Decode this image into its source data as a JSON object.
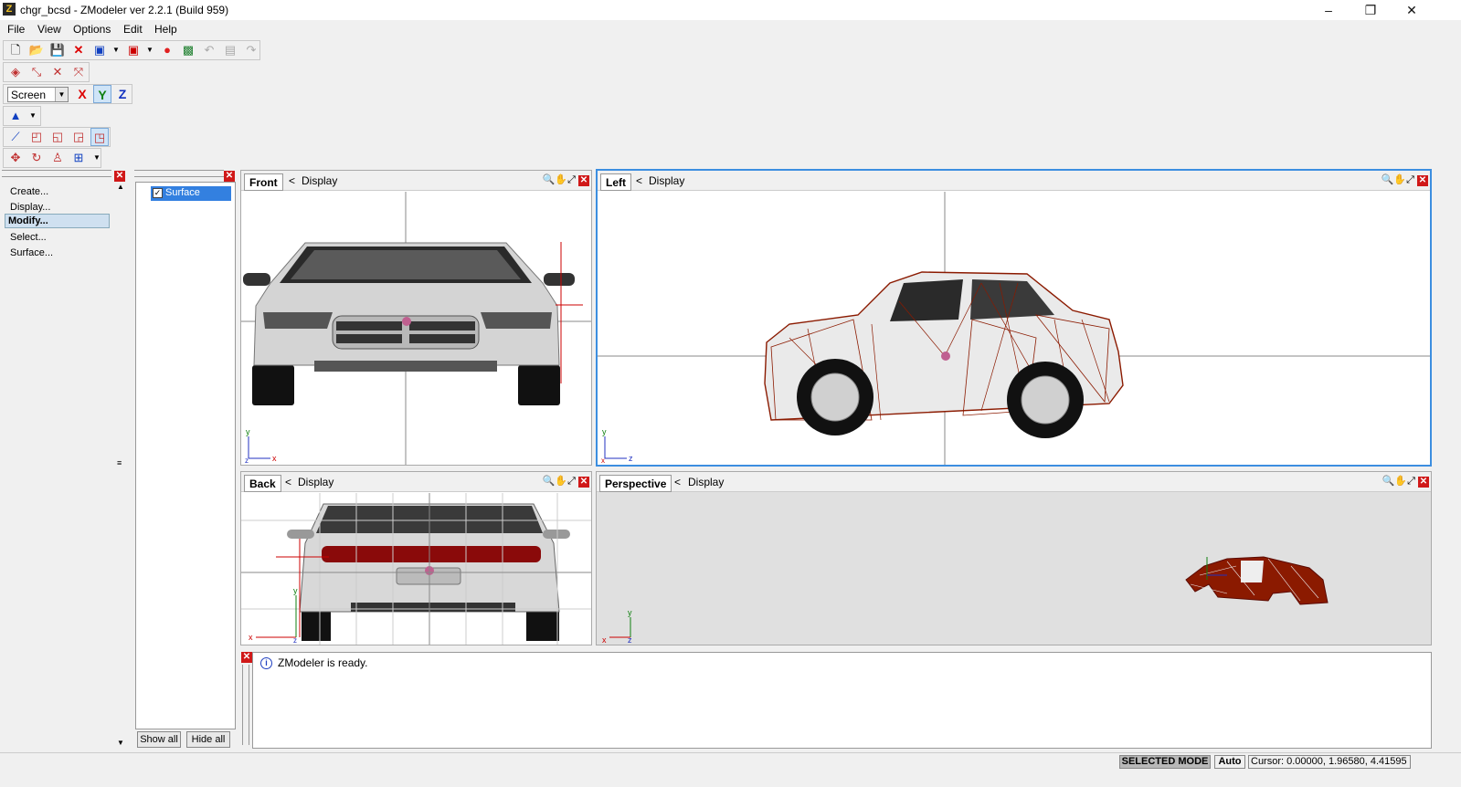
{
  "window": {
    "title": "chgr_bcsd - ZModeler ver 2.2.1 (Build 959)",
    "app_icon": "Z",
    "minimize": "–",
    "maximize": "❐",
    "close": "✕"
  },
  "menu": [
    "File",
    "View",
    "Options",
    "Edit",
    "Help"
  ],
  "toolbar": {
    "axis_mode": "Screen",
    "axis_x": "X",
    "axis_y": "Y",
    "axis_z": "Z"
  },
  "commands": {
    "items": [
      "Create...",
      "Display...",
      "Modify...",
      "Select...",
      "Surface..."
    ],
    "selected_index": 2
  },
  "objects": {
    "items": [
      {
        "label": "Surface",
        "checked": true
      }
    ],
    "show_all": "Show all",
    "hide_all": "Hide all"
  },
  "viewports": {
    "front": {
      "name": "Front",
      "display": "Display",
      "axis_h": "x",
      "axis_v": "y",
      "axis_o": "z"
    },
    "left": {
      "name": "Left",
      "display": "Display",
      "axis_h": "z",
      "axis_v": "y",
      "axis_o": "x"
    },
    "back": {
      "name": "Back",
      "display": "Display",
      "axis_h": "x",
      "axis_v": "y",
      "axis_o": "z"
    },
    "perspective": {
      "name": "Perspective",
      "display": "Display",
      "axis_h": "z",
      "axis_v": "y",
      "axis_o": "x"
    },
    "display_arrow": "<"
  },
  "log": {
    "message": "ZModeler is ready.",
    "info_icon": "i"
  },
  "statusbar": {
    "mode": "SELECTED MODE",
    "auto": "Auto",
    "cursor": "Cursor: 0.00000, 1.96580, 4.41595"
  },
  "colors": {
    "active_border": "#3c8ee0",
    "mesh": "#8b1a00",
    "close_red": "#d01818"
  }
}
